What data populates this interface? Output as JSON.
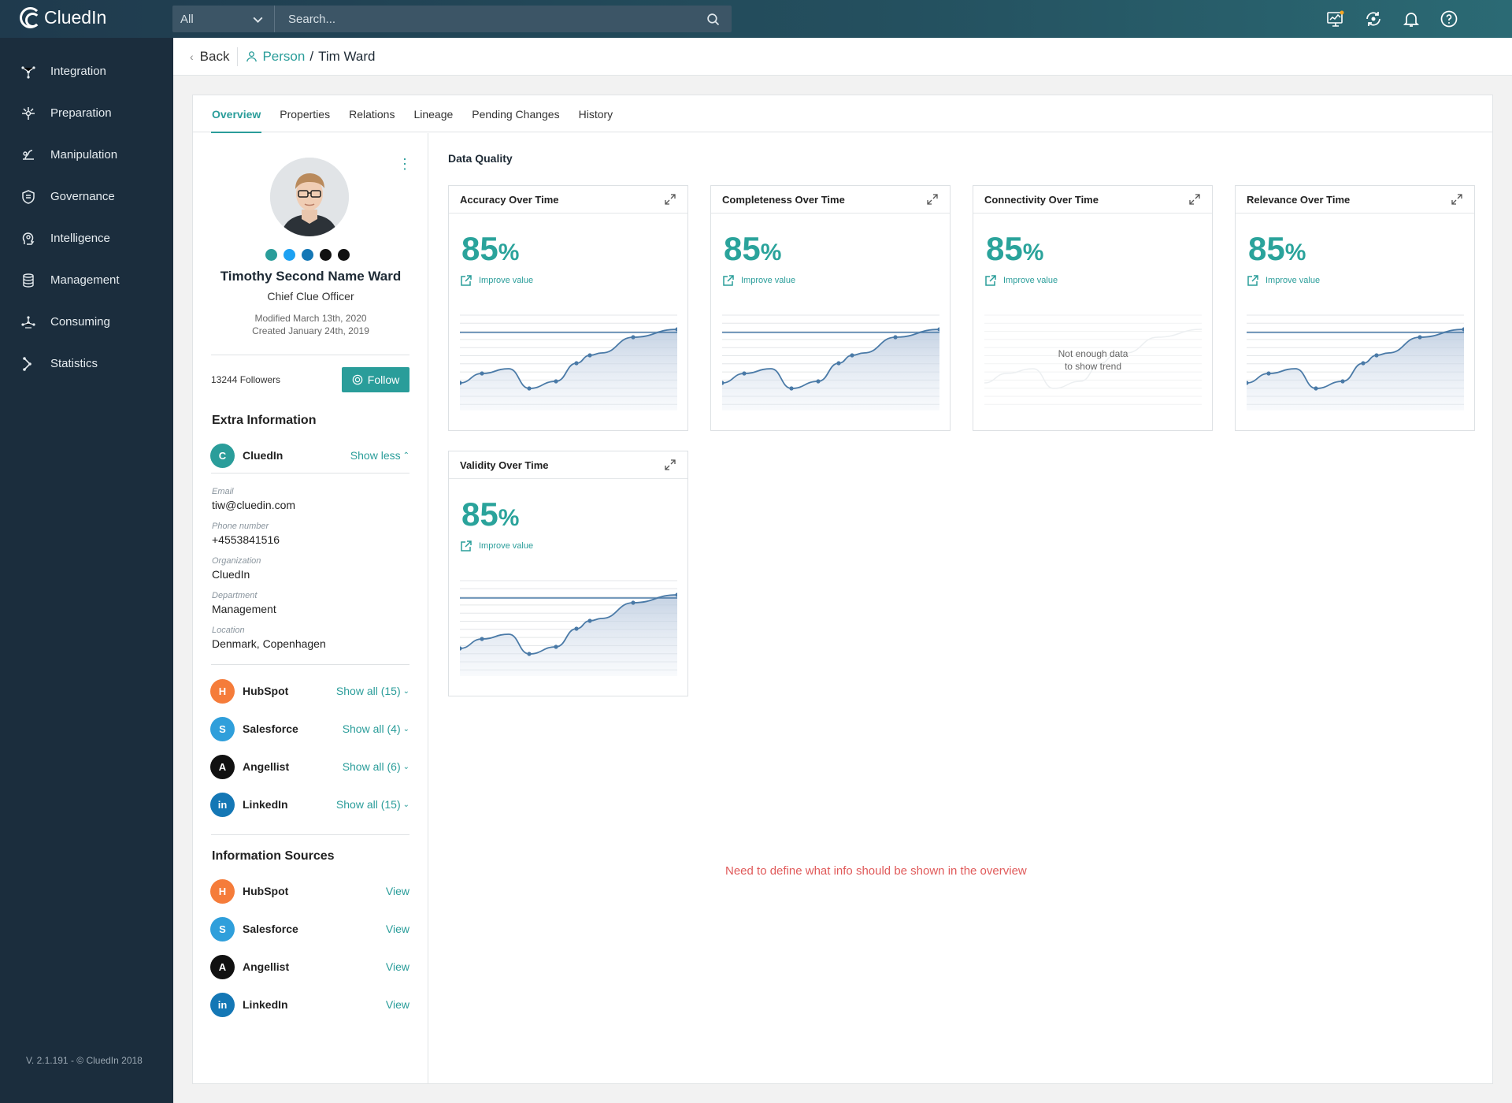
{
  "app": {
    "name": "CluedIn",
    "version": "V. 2.1.191 - © CluedIn  2018"
  },
  "search": {
    "scope": "All",
    "placeholder": "Search..."
  },
  "top_icons": [
    "monitor-icon",
    "sync-icon",
    "bell-icon",
    "help-icon"
  ],
  "sidebar": {
    "items": [
      {
        "label": "Integration",
        "icon": "integration-icon"
      },
      {
        "label": "Preparation",
        "icon": "preparation-icon"
      },
      {
        "label": "Manipulation",
        "icon": "manipulation-icon"
      },
      {
        "label": "Governance",
        "icon": "governance-icon"
      },
      {
        "label": "Intelligence",
        "icon": "intelligence-icon"
      },
      {
        "label": "Management",
        "icon": "management-icon"
      },
      {
        "label": "Consuming",
        "icon": "consuming-icon"
      },
      {
        "label": "Statistics",
        "icon": "statistics-icon"
      }
    ]
  },
  "header": {
    "back": "Back",
    "crumb_type": "Person",
    "separator": "/",
    "crumb_name": "Tim Ward"
  },
  "tabs": [
    "Overview",
    "Properties",
    "Relations",
    "Lineage",
    "Pending Changes",
    "History"
  ],
  "profile": {
    "name": "Timothy Second Name Ward",
    "title": "Chief Clue Officer",
    "modified": "Modified March 13th, 2020",
    "created": "Created January 24th, 2019",
    "followers": "13244 Followers",
    "follow_label": "Follow"
  },
  "extra": {
    "title": "Extra Information",
    "source_name": "CluedIn",
    "show_less": "Show less",
    "fields": [
      {
        "label": "Email",
        "value": "tiw@cluedin.com"
      },
      {
        "label": "Phone number",
        "value": "+4553841516"
      },
      {
        "label": "Organization",
        "value": "CluedIn"
      },
      {
        "label": "Department",
        "value": "Management"
      },
      {
        "label": "Location",
        "value": "Denmark, Copenhagen"
      }
    ],
    "sources": [
      {
        "name": "HubSpot",
        "link": "Show all (15)",
        "color": "#f57c3a"
      },
      {
        "name": "Salesforce",
        "link": "Show all (4)",
        "color": "#2f9fdb"
      },
      {
        "name": "Angellist",
        "link": "Show all (6)",
        "color": "#111111"
      },
      {
        "name": "LinkedIn",
        "link": "Show all (15)",
        "color": "#1477b5"
      }
    ]
  },
  "info_sources": {
    "title": "Information Sources",
    "items": [
      {
        "name": "HubSpot",
        "link": "View",
        "color": "#f57c3a"
      },
      {
        "name": "Salesforce",
        "link": "View",
        "color": "#2f9fdb"
      },
      {
        "name": "Angellist",
        "link": "View",
        "color": "#111111"
      },
      {
        "name": "LinkedIn",
        "link": "View",
        "color": "#1477b5"
      }
    ]
  },
  "data_quality": {
    "title": "Data Quality",
    "improve_label": "Improve value",
    "metrics": [
      {
        "title": "Accuracy Over Time",
        "value": "85",
        "unit": "%",
        "has_trend": true
      },
      {
        "title": "Completeness Over Time",
        "value": "85",
        "unit": "%",
        "has_trend": true
      },
      {
        "title": "Connectivity Over Time",
        "value": "85",
        "unit": "%",
        "has_trend": false,
        "no_data_line1": "Not enough data",
        "no_data_line2": "to show trend"
      },
      {
        "title": "Relevance Over Time",
        "value": "85",
        "unit": "%",
        "has_trend": true
      },
      {
        "title": "Validity Over Time",
        "value": "85",
        "unit": "%",
        "has_trend": true
      }
    ]
  },
  "note": "Need to define what info should be shown in the overview",
  "colors": {
    "accent": "#2a9d9a",
    "sidebar": "#1b2d3d",
    "note": "#e05a5a"
  }
}
